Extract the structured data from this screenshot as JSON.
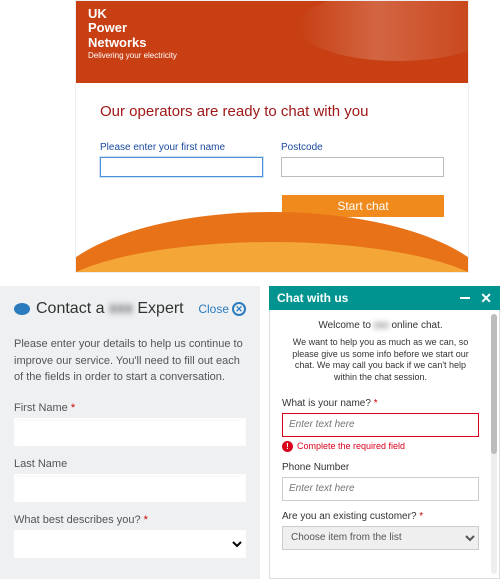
{
  "panel1": {
    "logo": {
      "line1": "UK",
      "line2": "Power",
      "line3": "Networks",
      "tagline": "Delivering your electricity"
    },
    "title": "Our operators are ready to chat with you",
    "first_name_label": "Please enter your first name",
    "postcode_label": "Postcode",
    "start_chat_label": "Start chat"
  },
  "panel2": {
    "title_prefix": "Contact a ",
    "title_blur": "xxx",
    "title_suffix": " Expert",
    "close_label": "Close",
    "intro": "Please enter your details to help us continue to improve our service. You'll need to fill out each of the fields in order to start a conversation.",
    "first_name_label": "First Name",
    "last_name_label": "Last Name",
    "describe_label": "What best describes you?",
    "required_marker": "*"
  },
  "panel3": {
    "header_title": "Chat with us",
    "welcome_prefix": "Welcome to ",
    "welcome_blur": "xxx",
    "welcome_suffix": " online chat.",
    "description": "We want to help you as much as we can, so please give us some info before we start our chat. We may call you back if we can't help within the chat session.",
    "name_label": "What is your name?",
    "name_placeholder": "Enter text here",
    "error_text": "Complete the required field",
    "phone_label": "Phone Number",
    "phone_placeholder": "Enter text here",
    "existing_label": "Are you an existing customer?",
    "select_placeholder": "Choose item from the list",
    "required_marker": "*"
  }
}
